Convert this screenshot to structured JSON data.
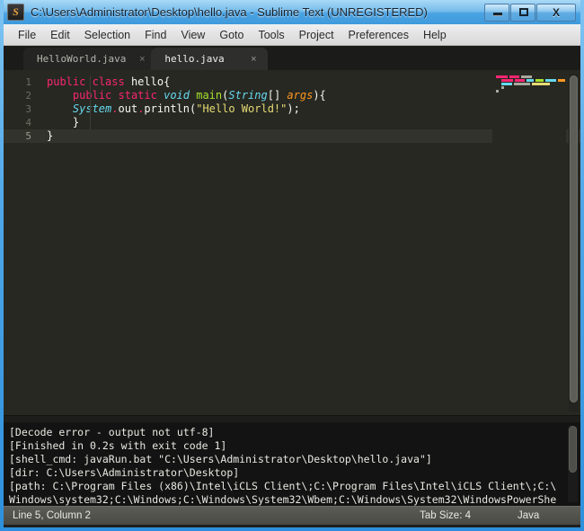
{
  "window": {
    "title": "C:\\Users\\Administrator\\Desktop\\hello.java - Sublime Text (UNREGISTERED)",
    "app_icon": "sublime-text-icon",
    "accent_color": "#2e90dc",
    "controls": {
      "minimize": "minimize-icon",
      "maximize": "maximize-icon",
      "close": "X"
    }
  },
  "menubar": {
    "items": [
      {
        "label": "File"
      },
      {
        "label": "Edit"
      },
      {
        "label": "Selection"
      },
      {
        "label": "Find"
      },
      {
        "label": "View"
      },
      {
        "label": "Goto"
      },
      {
        "label": "Tools"
      },
      {
        "label": "Project"
      },
      {
        "label": "Preferences"
      },
      {
        "label": "Help"
      }
    ]
  },
  "tabs": {
    "close_glyph": "×",
    "items": [
      {
        "label": "HelloWorld.java",
        "active": false
      },
      {
        "label": "hello.java",
        "active": true
      }
    ]
  },
  "editor": {
    "theme": "Monokai",
    "background": "#272822",
    "current_line": 5,
    "line_numbers": [
      "1",
      "2",
      "3",
      "4",
      "5"
    ],
    "lines": [
      {
        "n": 1,
        "text": "public class hello{"
      },
      {
        "n": 2,
        "text": "    public static void main(String[] args){"
      },
      {
        "n": 3,
        "text": "    System.out.println(\"Hello World!\");"
      },
      {
        "n": 4,
        "text": "    }"
      },
      {
        "n": 5,
        "text": "}"
      }
    ],
    "colors": {
      "keyword": "#f92672",
      "type": "#66d9ef",
      "function": "#a6e22e",
      "parameter": "#fd971f",
      "string": "#e6db74",
      "plain": "#f8f8f2"
    }
  },
  "console": {
    "lines": [
      "[Decode error - output not utf-8]",
      "[Finished in 0.2s with exit code 1]",
      "[shell_cmd: javaRun.bat \"C:\\Users\\Administrator\\Desktop\\hello.java\"]",
      "[dir: C:\\Users\\Administrator\\Desktop]",
      "[path: C:\\Program Files (x86)\\Intel\\iCLS Client\\;C:\\Program Files\\Intel\\iCLS Client\\;C:\\",
      "Windows\\system32;C:\\Windows;C:\\Windows\\System32\\Wbem;C:\\Windows\\System32\\WindowsPowerShe"
    ]
  },
  "statusbar": {
    "cursor_position": "Line 5, Column 2",
    "tab_size": "Tab Size: 4",
    "language": "Java"
  }
}
